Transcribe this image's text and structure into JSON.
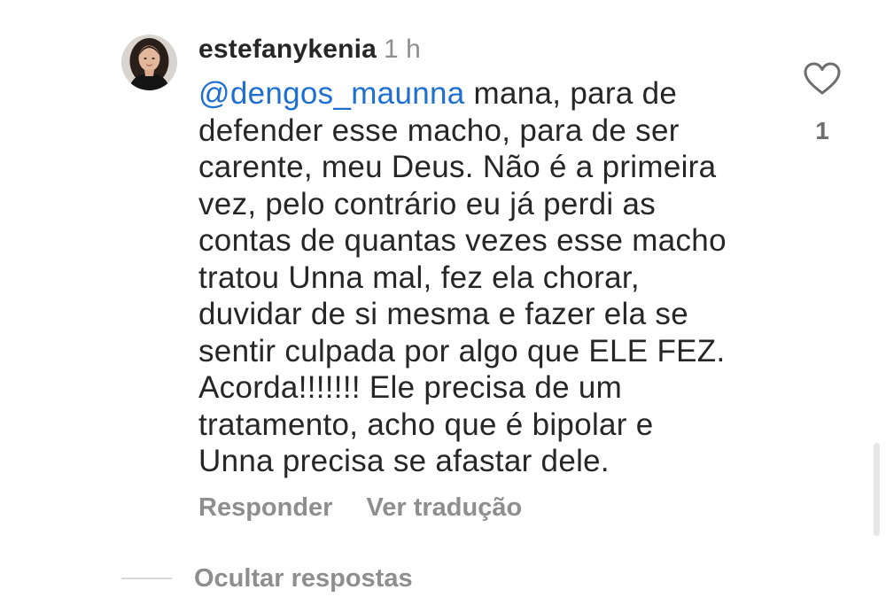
{
  "comment": {
    "username": "estefanykenia",
    "timestamp": "1 h",
    "mention": "@dengos_maunna",
    "text_lines": [
      " mana, para de",
      "defender esse macho, para de ser",
      "carente, meu Deus. Não é a primeira",
      "vez, pelo contrário eu já perdi as",
      "contas de quantas vezes esse macho",
      "tratou Unna mal, fez ela chorar,",
      "duvidar de si mesma e fazer ela se",
      "sentir culpada por algo que ELE FEZ.",
      "Acorda!!!!!!! Ele precisa de um",
      "tratamento, acho que é bipolar e",
      "Unna precisa se afastar dele."
    ],
    "like_count": "1",
    "actions": {
      "reply_label": "Responder",
      "translate_label": "Ver tradução"
    }
  },
  "replies": {
    "toggle_label": "Ocultar respostas"
  },
  "icons": {
    "like": "heart-outline-icon",
    "avatar": "user-avatar-photo"
  },
  "colors": {
    "text": "#262626",
    "secondary": "#8e8e8e",
    "mention": "#1f6fd1",
    "background": "#ffffff"
  }
}
